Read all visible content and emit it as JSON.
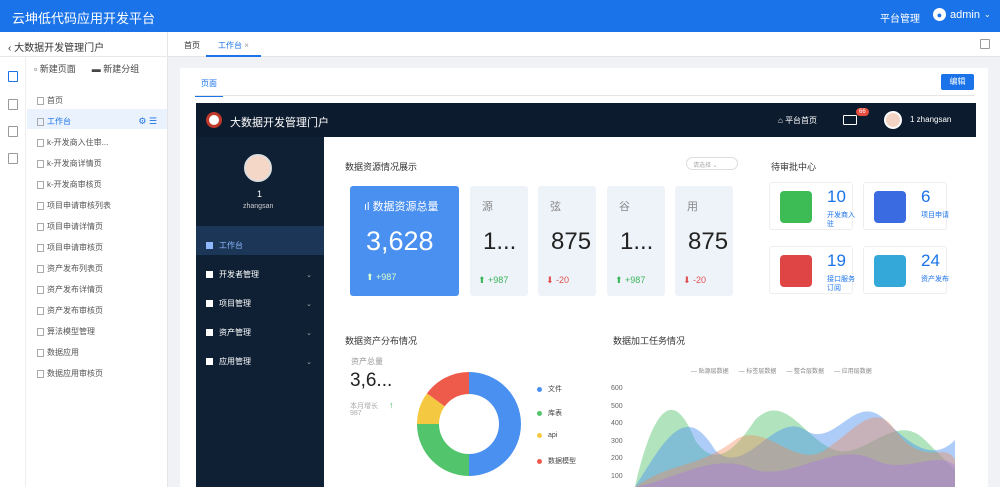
{
  "app": {
    "title": "云坤低代码应用开发平台",
    "nav_label": "平台管理",
    "user": "admin"
  },
  "left_panel": {
    "back_title": "大数据开发管理门户",
    "new_page": "新建页面",
    "new_group": "新建分组",
    "items": [
      {
        "label": "首页"
      },
      {
        "label": "工作台",
        "active": true
      },
      {
        "label": "k-开发商入住审..."
      },
      {
        "label": "k-开发商详情页"
      },
      {
        "label": "k-开发商审核页"
      },
      {
        "label": "项目申请审核列表"
      },
      {
        "label": "项目申请详情页"
      },
      {
        "label": "项目申请审核页"
      },
      {
        "label": "资产发布列表页"
      },
      {
        "label": "资产发布详情页"
      },
      {
        "label": "资产发布审核页"
      },
      {
        "label": "算法模型管理"
      },
      {
        "label": "数据应用"
      },
      {
        "label": "数据应用审核页"
      }
    ]
  },
  "tabs": [
    {
      "label": "首页"
    },
    {
      "label": "工作台",
      "closable": "×"
    }
  ],
  "content": {
    "subtab": "页面",
    "edit_btn": "编辑"
  },
  "portal": {
    "title": "大数据开发管理门户",
    "home": "平台首页",
    "mail_badge": "66",
    "username": "1   zhangsan",
    "sidebar_user_num": "1",
    "sidebar_user_name": "zhangsan",
    "nav": [
      {
        "label": "工作台",
        "active": true
      },
      {
        "label": "开发者管理"
      },
      {
        "label": "项目管理"
      },
      {
        "label": "资产管理"
      },
      {
        "label": "应用管理"
      }
    ]
  },
  "stats": {
    "title": "数据资源情况展示",
    "filter": "请选择",
    "main": {
      "label": "数据资源总量",
      "value": "3,628",
      "delta": "+987"
    },
    "cards": [
      {
        "icon": "源",
        "value": "1...",
        "delta": "+987",
        "dir": "up"
      },
      {
        "icon": "弦",
        "value": "875",
        "delta": "-20",
        "dir": "down"
      },
      {
        "icon": "谷",
        "value": "1...",
        "delta": "+987",
        "dir": "up"
      },
      {
        "icon": "用",
        "value": "875",
        "delta": "-20",
        "dir": "down"
      }
    ]
  },
  "approval": {
    "title": "待审批中心",
    "items": [
      {
        "num": "10",
        "label": "开发商入驻",
        "color": "#3dbb55"
      },
      {
        "num": "6",
        "label": "项目申请",
        "color": "#3a6be0"
      },
      {
        "num": "19",
        "label": "接口服务订阅",
        "color": "#e04545"
      },
      {
        "num": "24",
        "label": "资产发布",
        "color": "#34a8d8"
      }
    ]
  },
  "distribution": {
    "title": "数据资产分布情况",
    "total_label": "资产总量",
    "total_value": "3,6...",
    "month_label": "本月增长",
    "month_value": "987",
    "legend": [
      {
        "label": "文件",
        "color": "#4a90f0"
      },
      {
        "label": "库表",
        "color": "#52c46c"
      },
      {
        "label": "api",
        "color": "#f5c842"
      },
      {
        "label": "数据模型",
        "color": "#ef5b4b"
      }
    ],
    "slices": [
      0.5,
      0.25,
      0.1,
      0.15
    ]
  },
  "tasks": {
    "title": "数据加工任务情况",
    "legend": [
      "贴源层数据",
      "标签层数据",
      "整合层数据",
      "应用层数据"
    ],
    "yticks": [
      "600",
      "500",
      "400",
      "300",
      "200",
      "100"
    ]
  }
}
